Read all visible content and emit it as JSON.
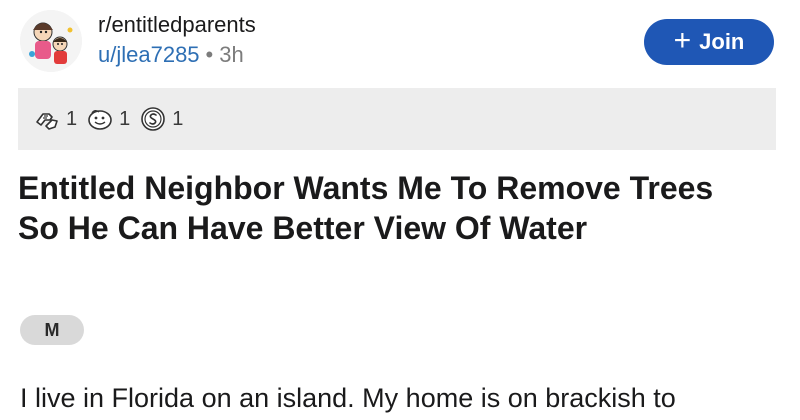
{
  "post": {
    "subreddit": "r/entitledparents",
    "username": "u/jlea7285",
    "separator": "•",
    "time_ago": "3h",
    "join_label": "Join",
    "join_icon": "plus-icon",
    "awards": [
      {
        "icon": "fistbump-award-icon",
        "count": "1"
      },
      {
        "icon": "wholesome-award-icon",
        "count": "1"
      },
      {
        "icon": "silver-coin-award-icon",
        "count": "1"
      }
    ],
    "title": "Entitled Neighbor Wants Me To Remove Trees So He Can Have Better View Of Water",
    "flair": "M",
    "body_first_line": "I live in Florida on an island. My home is on brackish to"
  },
  "colors": {
    "join_button": "#1f57b5",
    "username_link": "#2e6fb4",
    "awards_bar": "#ededed",
    "flair_bg": "#d9d9d9"
  }
}
